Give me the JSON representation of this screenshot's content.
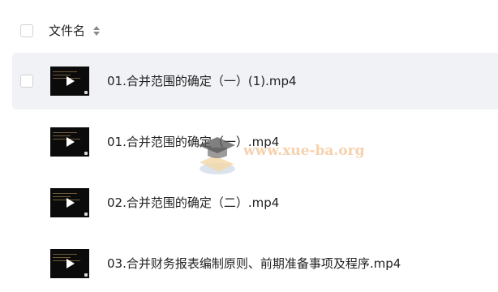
{
  "header": {
    "column_label": "文件名"
  },
  "files": [
    {
      "name": "01.合并范围的确定（一）(1).mp4",
      "hovered": true
    },
    {
      "name": "01.合并范围的确定（一）.mp4",
      "hovered": false
    },
    {
      "name": "02.合并范围的确定（二）.mp4",
      "hovered": false
    },
    {
      "name": "03.合并财务报表编制原则、前期准备事项及程序.mp4",
      "hovered": false
    }
  ],
  "watermark": {
    "text": "www.xue-ba.org"
  },
  "icons": {
    "sort": "sort-updown-icon",
    "play": "play-icon",
    "watermark_logo": "graduation-cap-icon"
  },
  "colors": {
    "hover_background": "#f1f2f6",
    "checkbox_border": "#d2d2d2",
    "watermark_text": "#f4c9a0"
  }
}
